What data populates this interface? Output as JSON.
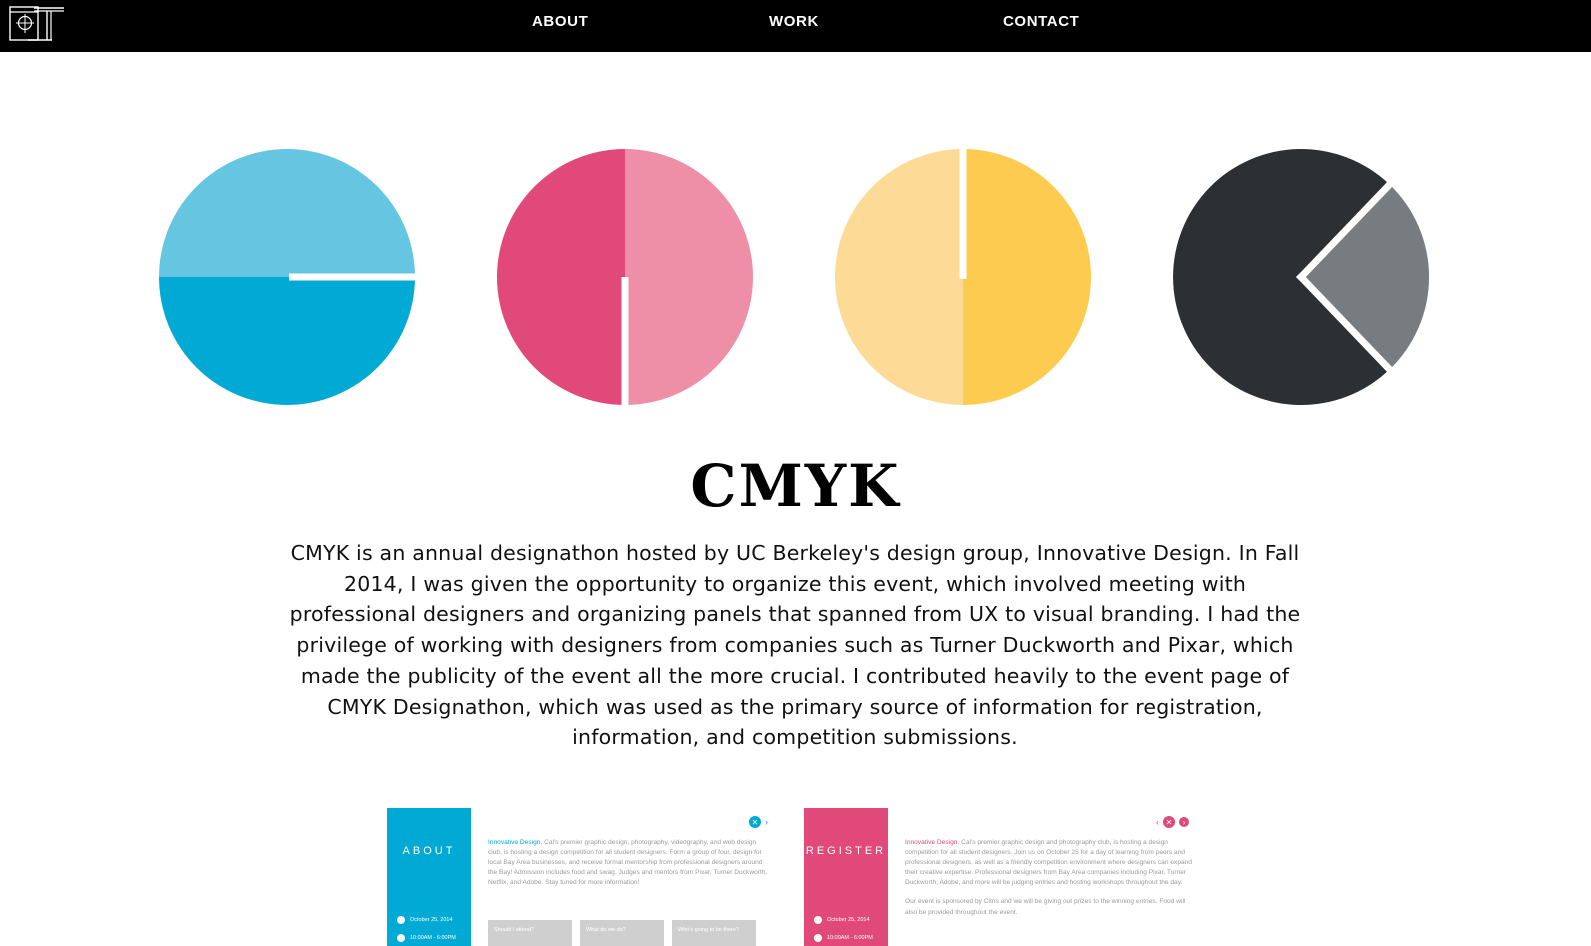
{
  "nav": {
    "links": [
      "ABOUT",
      "WORK",
      "CONTACT"
    ]
  },
  "page": {
    "title": "CMYK",
    "description": "CMYK is an annual designathon hosted by UC Berkeley's design group, Innovative Design. In Fall 2014, I was given the opportunity to organize this event, which involved meeting with professional designers and organizing panels that spanned from UX to visual branding. I had the privilege of working with designers from companies such as Turner Duckworth and Pixar, which made the publicity of the event all the more crucial. I contributed heavily to the event page of CMYK Designathon, which was used as the primary source of information for registration, information, and competition submissions."
  },
  "colors": {
    "cyan_light": "#66c6e1",
    "cyan": "#00aad4",
    "magenta": "#e0497a",
    "magenta_light": "#ee8fa7",
    "yellow_light": "#fddb96",
    "yellow": "#fdcb50",
    "black": "#2d3033",
    "gray": "#767c7f"
  },
  "screens": [
    {
      "side_title": "ABOUT",
      "date": "October 25, 2014",
      "time": "10:00AM - 6:00PM",
      "highlight": "Innovative Design",
      "paragraphs": [
        ", Cal's premier graphic design, photography, videography, and web design club, is hosting a design competition for all student designers. Form a group of four, design for local Bay Area businesses, and receive formal mentorship from professional designers around the Bay! Admission includes food and swag. Judges and mentors from Pixar, Turner Duckworth, Netflix, and Adobe. Stay tuned for more information!"
      ],
      "buttons": [
        "Should I attend?",
        "What do we do?",
        "Who's going to be there?"
      ]
    },
    {
      "side_title": "REGISTER",
      "date": "October 25, 2014",
      "time": "10:00AM - 6:00PM",
      "highlight": "Innovative Design",
      "paragraphs": [
        ", Cal's premier graphic design and photography club, is hosting a design competition for all student designers. Join us on October 25 for a day of learning from peers and professional designers, as well as a friendly competition environment where designers can expand their creative expertise. Professional designers from Bay Area companies including Pixar, Turner Duckworth, Adobe, and more will be judging entries and hosting workshops throughout the day.",
        "Our event is sponsored by Citris and we will be giving out prizes to the winning entries. Food will also be provided throughout the event."
      ],
      "buttons": []
    }
  ]
}
